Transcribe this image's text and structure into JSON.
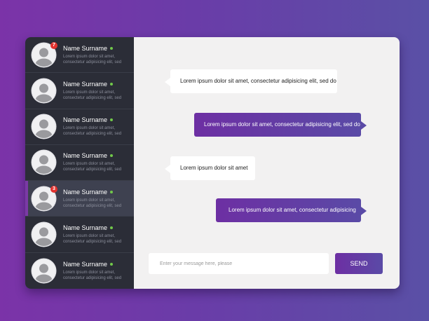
{
  "colors": {
    "accent": "#6d2fa3",
    "sidebar": "#2b2d37",
    "online": "#71c84a",
    "badge": "#e2322e"
  },
  "contacts": [
    {
      "name": "Name Surname",
      "preview": "Lorem ipsum dolor sit amet, consectetur adipisicing elit, sed",
      "badge": "7"
    },
    {
      "name": "Name Surname",
      "preview": "Lorem ipsum dolor sit amet, consectetur adipisicing elit, sed"
    },
    {
      "name": "Name Surname",
      "preview": "Lorem ipsum dolor sit amet, consectetur adipisicing elit, sed"
    },
    {
      "name": "Name Surname",
      "preview": "Lorem ipsum dolor sit amet, consectetur adipisicing elit, sed"
    },
    {
      "name": "Name Surname",
      "preview": "Lorem ipsum dolor sit amet, consectetur adipisicing elit, sed",
      "badge": "3",
      "active": true
    },
    {
      "name": "Name Surname",
      "preview": "Lorem ipsum dolor sit amet, consectetur adipisicing elit, sed"
    },
    {
      "name": "Name Surname",
      "preview": "Lorem ipsum dolor sit amet, consectetur adipisicing elit, sed"
    }
  ],
  "messages": [
    {
      "direction": "in",
      "text": "Lorem ipsum dolor sit amet, consectetur adipisicing elit, sed do"
    },
    {
      "direction": "out",
      "text": "Lorem ipsum dolor sit amet, consectetur adipisicing elit, sed do"
    },
    {
      "direction": "in",
      "text": "Lorem ipsum dolor sit amet"
    },
    {
      "direction": "out",
      "text": "Lorem ipsum dolor sit amet, consectetur adipisicing"
    }
  ],
  "composer": {
    "placeholder": "Enter your message here, please",
    "value": "",
    "send_label": "SEND"
  }
}
